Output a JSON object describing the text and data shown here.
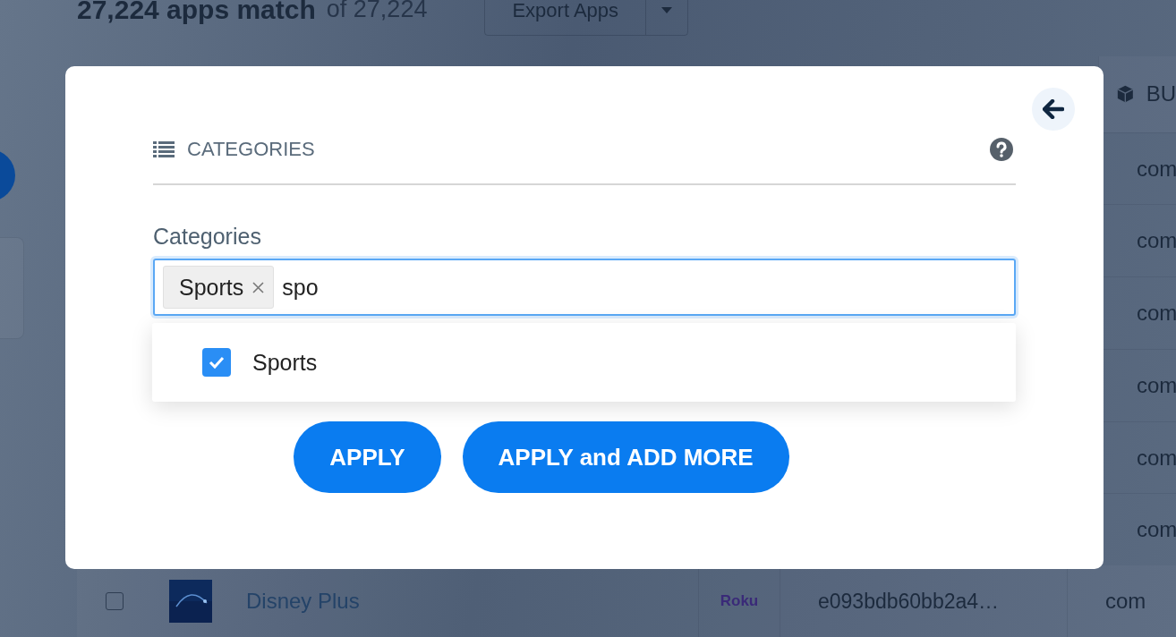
{
  "header": {
    "count": "27,224 apps match",
    "total": "of 27,224",
    "export_button": "Export Apps"
  },
  "table": {
    "column_header": "BU",
    "cells": [
      "com",
      "com",
      "com",
      "com",
      "com",
      "com"
    ],
    "row": {
      "checked": false,
      "name": "Disney Plus",
      "platform": "Roku",
      "id": "e093bdb60bb2a4…",
      "column_5": "com"
    }
  },
  "modal": {
    "section_title": "CATEGORIES",
    "field": {
      "label": "Categories",
      "tags": [
        {
          "label": "Sports"
        }
      ],
      "value": "spo"
    },
    "options": [
      {
        "label": "Sports",
        "checked": true
      }
    ],
    "buttons": [
      "APPLY",
      "APPLY and ADD MORE"
    ]
  }
}
